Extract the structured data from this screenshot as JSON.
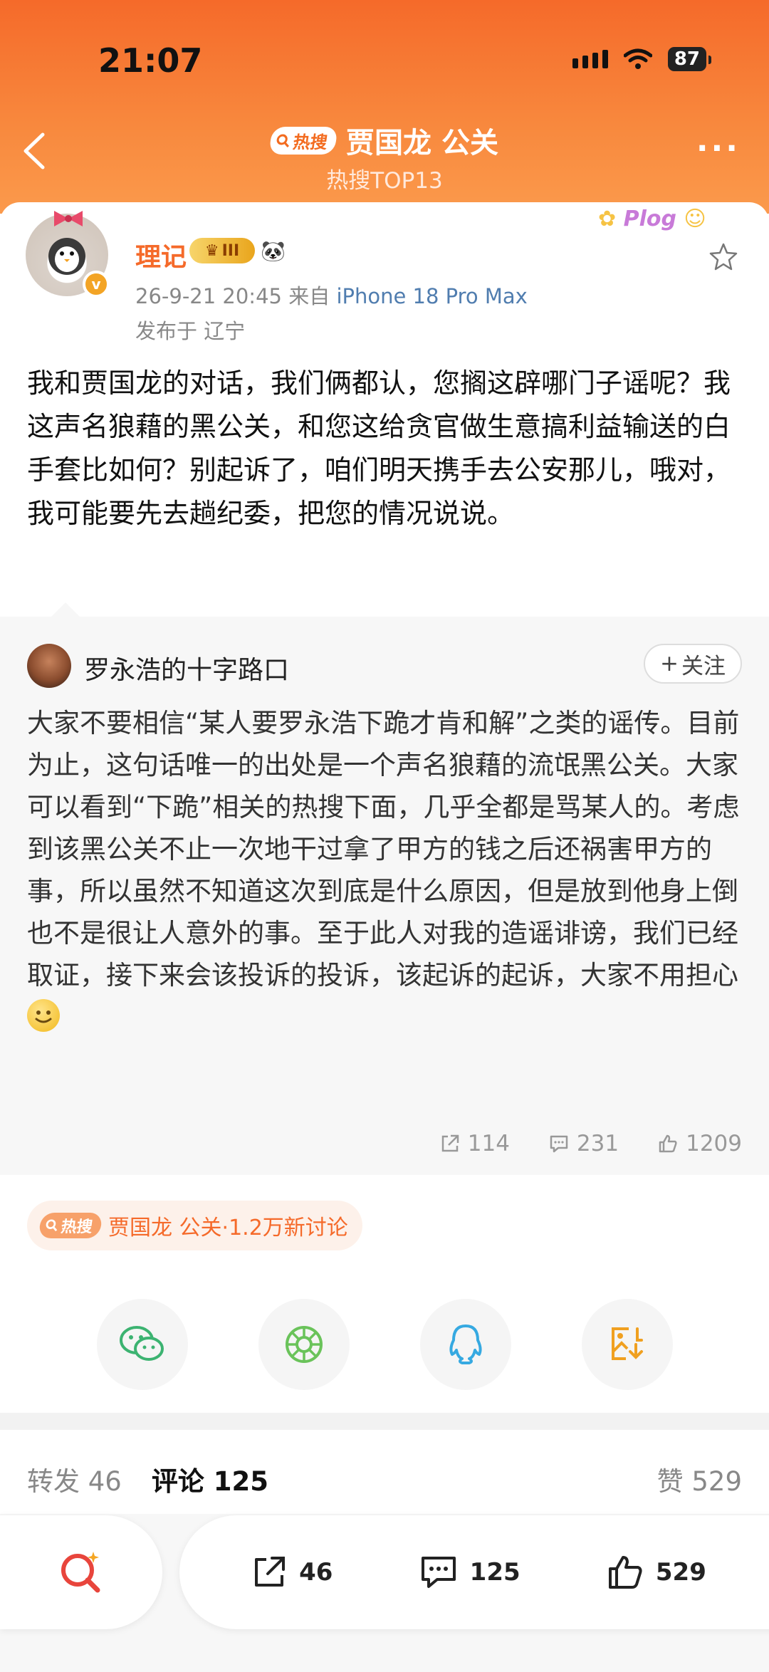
{
  "status_bar": {
    "time": "21:07",
    "battery": "87"
  },
  "nav": {
    "hot_label": "热搜",
    "title": "贾国龙 公关",
    "subtitle": "热搜TOP13"
  },
  "post": {
    "author": "理记",
    "vip_level": "III",
    "timestamp": "26-9-21 20:45",
    "source_prefix": "来自",
    "device": "iPhone 18 Pro Max",
    "location": "发布于 辽宁",
    "sticker_text": "Plog",
    "text": "我和贾国龙的对话，我们俩都认，您搁这辟哪门子谣呢？我这声名狼藉的黑公关，和您这给贪官做生意搞利益输送的白手套比如何？别起诉了，咱们明天携手去公安那儿，哦对，我可能要先去趟纪委，把您的情况说说。"
  },
  "repost": {
    "author": "罗永浩的十字路口",
    "follow_label": "关注",
    "text": "大家不要相信“某人要罗永浩下跪才肯和解”之类的谣传。目前为止，这句话唯一的出处是一个声名狼藉的流氓黑公关。大家可以看到“下跪”相关的热搜下面，几乎全都是骂某人的。考虑到该黑公关不止一次地干过拿了甲方的钱之后还祸害甲方的事，所以虽然不知道这次到底是什么原因，但是放到他身上倒也不是很让人意外的事。至于此人对我的造谣诽谤，我们已经取证，接下来会该投诉的投诉，该起诉的起诉，大家不用担心",
    "reposts": "114",
    "comments": "231",
    "likes": "1209"
  },
  "topic": {
    "hot_label": "热搜",
    "text": "贾国龙 公关·1.2万新讨论"
  },
  "share_targets": [
    "wechat-icon",
    "moments-icon",
    "qq-icon",
    "save-image-icon"
  ],
  "tabs": {
    "reposts": "转发 46",
    "comments": "评论 125",
    "likes": "赞 529"
  },
  "bottom_bar": {
    "reposts": "46",
    "comments": "125",
    "likes": "529"
  },
  "colors": {
    "accent": "#f56a2a",
    "link": "#507daf"
  }
}
